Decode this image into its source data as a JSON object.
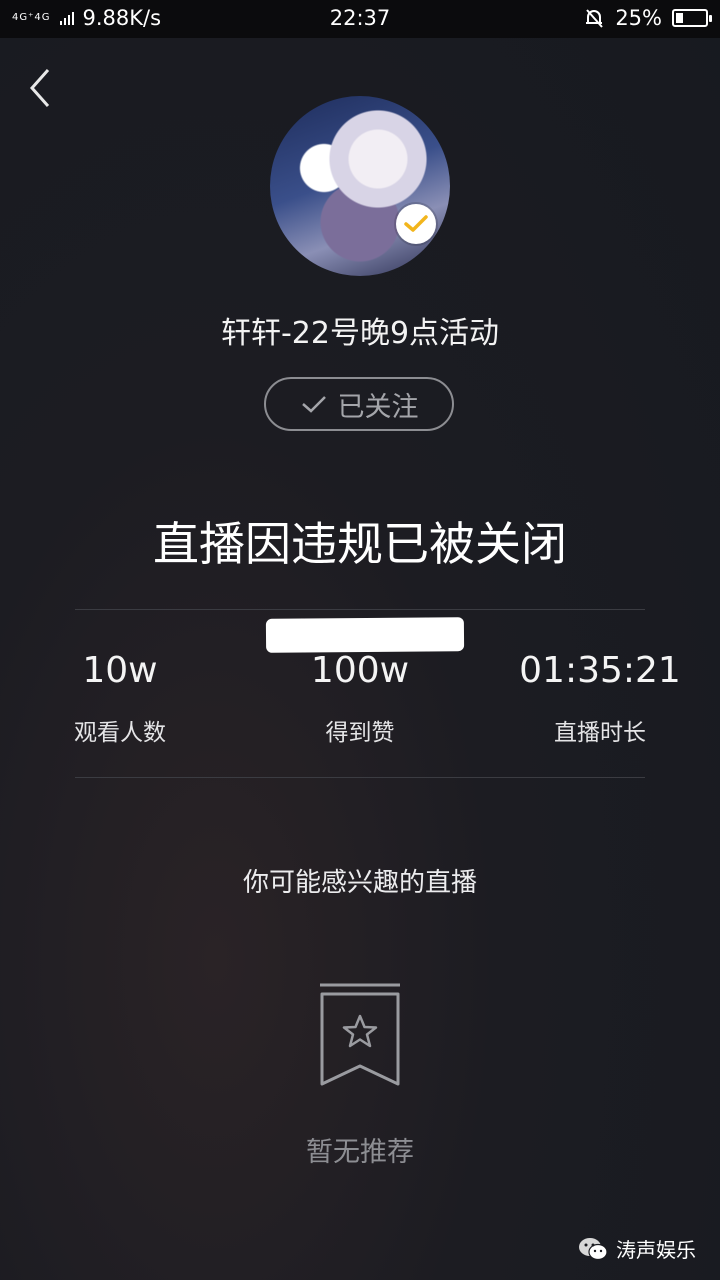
{
  "status_bar": {
    "network": "4G⁺4G",
    "speed": "9.88K/s",
    "time": "22:37",
    "battery_percent": "25%",
    "battery_level": 0.25
  },
  "streamer": {
    "name": "轩轩-22号晚9点活动",
    "follow_label": "已关注"
  },
  "closed_message": "直播因违规已被关闭",
  "stats": [
    {
      "value": "10w",
      "label": "观看人数"
    },
    {
      "value": "100w",
      "label": "得到赞"
    },
    {
      "value": "01:35:21",
      "label": "直播时长"
    }
  ],
  "recommendations": {
    "title": "你可能感兴趣的直播",
    "empty_text": "暂无推荐"
  },
  "watermark": "涛声娱乐",
  "icons": {
    "back": "chevron-left-icon",
    "verified": "check-badge-icon",
    "follow_check": "check-icon",
    "empty": "bookmark-star-icon",
    "watermark": "wechat-icon",
    "alarm": "bell-off-icon"
  },
  "colors": {
    "verified_check": "#f2b51c",
    "background": "#1b1c22"
  }
}
